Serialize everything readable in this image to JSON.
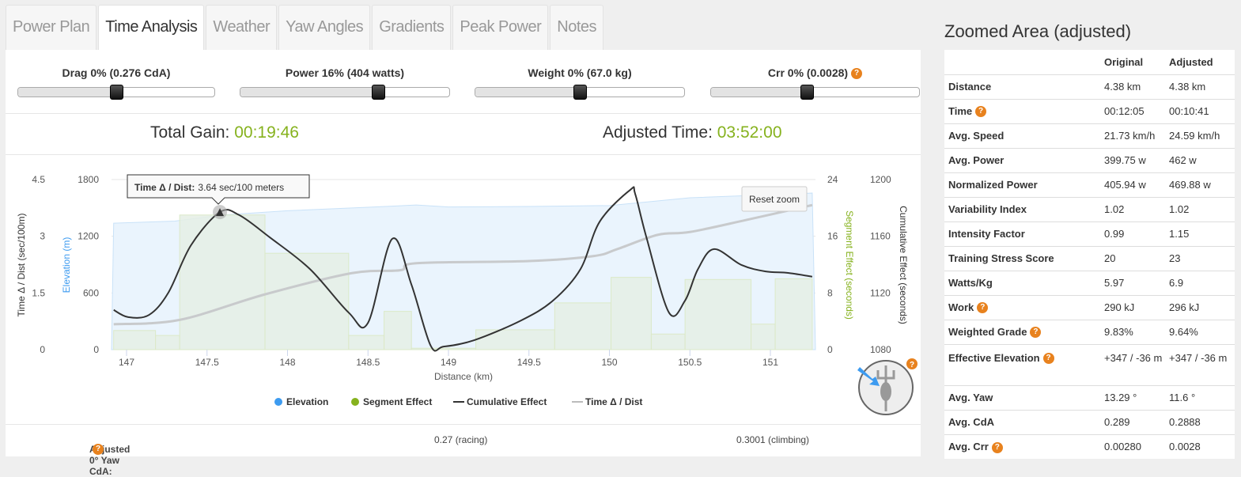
{
  "tabs": [
    {
      "label": "Power Plan"
    },
    {
      "label": "Time Analysis",
      "active": true
    },
    {
      "label": "Weather"
    },
    {
      "label": "Yaw Angles"
    },
    {
      "label": "Gradients"
    },
    {
      "label": "Peak Power"
    },
    {
      "label": "Notes"
    }
  ],
  "sliders": [
    {
      "label": "Drag 0% (0.276 CdA)",
      "value_pct": 50
    },
    {
      "label": "Power 16% (404 watts)",
      "value_pct": 66
    },
    {
      "label": "Weight 0% (67.0 kg)",
      "value_pct": 50
    },
    {
      "label": "Crr 0% (0.0028)",
      "value_pct": 46,
      "help": "?"
    }
  ],
  "summary": {
    "gain_label": "Total Gain:",
    "gain_value": "00:19:46",
    "adjusted_label": "Adjusted Time:",
    "adjusted_value": "03:52:00"
  },
  "colors": {
    "accent_green": "#86b21e",
    "elevation": "#3d9bf0",
    "help": "#e8821e"
  },
  "reset_zoom": "Reset zoom",
  "tooltip": {
    "label": "Time Δ / Dist:",
    "value": "3.64 sec/100 meters"
  },
  "chart_data": {
    "type": "line",
    "xlabel": "Distance (km)",
    "xlim": [
      146.92,
      151.26
    ],
    "xticks": [
      "147",
      "147.5",
      "148",
      "148.5",
      "149",
      "149.5",
      "150",
      "150.5",
      "151"
    ],
    "axes": {
      "time_dist": {
        "label": "Time Δ / Dist (sec/100m)",
        "range": [
          0,
          4.5
        ],
        "ticks": [
          "0",
          "1.5",
          "3",
          "4.5"
        ]
      },
      "elevation": {
        "label": "Elevation (m)",
        "range": [
          0,
          1800
        ],
        "ticks": [
          "0",
          "600",
          "1200",
          "1800"
        ]
      },
      "segment": {
        "label": "Segment Effect (seconds)",
        "range": [
          0,
          24
        ],
        "ticks": [
          "0",
          "8",
          "16",
          "24"
        ]
      },
      "cumulative": {
        "label": "Cumulative Effect (seconds)",
        "range": [
          1080,
          1200
        ],
        "ticks": [
          "1080",
          "1120",
          "1160",
          "1200"
        ]
      }
    },
    "legend": [
      "Elevation",
      "Segment Effect",
      "Cumulative Effect",
      "Time Δ / Dist"
    ],
    "legend_position": "bottom",
    "series": {
      "elevation": [
        [
          146.92,
          1339
        ],
        [
          147.3,
          1360
        ],
        [
          147.58,
          1423
        ],
        [
          148.0,
          1470
        ],
        [
          148.5,
          1507
        ],
        [
          148.8,
          1531
        ],
        [
          149.0,
          1510
        ],
        [
          149.5,
          1515
        ],
        [
          150.0,
          1525
        ],
        [
          150.5,
          1607
        ],
        [
          151.26,
          1657
        ]
      ],
      "segment_effect": [
        [
          146.92,
          147.18,
          2.7
        ],
        [
          147.18,
          147.33,
          2.0
        ],
        [
          147.33,
          147.86,
          19.0
        ],
        [
          147.86,
          148.38,
          13.6
        ],
        [
          148.38,
          148.6,
          2.0
        ],
        [
          148.6,
          148.77,
          5.4
        ],
        [
          148.77,
          149.17,
          0.2
        ],
        [
          149.17,
          149.66,
          2.8
        ],
        [
          149.66,
          150.01,
          6.6
        ],
        [
          150.01,
          150.26,
          10.2
        ],
        [
          150.26,
          150.47,
          2.2
        ],
        [
          150.47,
          150.88,
          9.9
        ],
        [
          150.88,
          151.03,
          3.6
        ],
        [
          151.03,
          151.26,
          10.0
        ]
      ],
      "time_dist": [
        [
          146.92,
          1.05
        ],
        [
          147.01,
          0.86
        ],
        [
          147.14,
          0.92
        ],
        [
          147.26,
          1.51
        ],
        [
          147.4,
          2.76
        ],
        [
          147.58,
          3.64
        ],
        [
          147.7,
          3.56
        ],
        [
          147.89,
          2.97
        ],
        [
          148.14,
          2.13
        ],
        [
          148.38,
          0.98
        ],
        [
          148.5,
          0.71
        ],
        [
          148.65,
          2.93
        ],
        [
          148.77,
          1.72
        ],
        [
          148.89,
          0.1
        ],
        [
          148.97,
          0.08
        ],
        [
          149.16,
          0.25
        ],
        [
          149.45,
          0.77
        ],
        [
          149.65,
          1.3
        ],
        [
          149.82,
          2.13
        ],
        [
          149.94,
          3.39
        ],
        [
          150.13,
          4.23
        ],
        [
          150.16,
          4.12
        ],
        [
          150.23,
          2.97
        ],
        [
          150.37,
          0.98
        ],
        [
          150.47,
          1.3
        ],
        [
          150.55,
          2.13
        ],
        [
          150.65,
          2.66
        ],
        [
          150.82,
          2.24
        ],
        [
          150.97,
          2.07
        ],
        [
          151.11,
          2.03
        ],
        [
          151.26,
          1.93
        ]
      ],
      "cumulative": [
        [
          146.92,
          1097.9
        ],
        [
          147.33,
          1101
        ],
        [
          147.86,
          1119
        ],
        [
          148.4,
          1134
        ],
        [
          148.7,
          1136
        ],
        [
          148.8,
          1141
        ],
        [
          149.5,
          1142.5
        ],
        [
          149.9,
          1146
        ],
        [
          150.05,
          1151
        ],
        [
          150.3,
          1161
        ],
        [
          150.5,
          1163
        ],
        [
          150.85,
          1171.5
        ],
        [
          151.26,
          1182
        ]
      ]
    }
  },
  "bottom": {
    "label": "Adjusted 0° Yaw CdA:",
    "racing": "0.27 (racing)",
    "climbing": "0.3001 (climbing)"
  },
  "side": {
    "title": "Zoomed Area (adjusted)",
    "headers": [
      "",
      "Original",
      "Adjusted"
    ],
    "rows": [
      {
        "label": "Distance",
        "original": "4.38 km",
        "adjusted": "4.38 km"
      },
      {
        "label": "Time",
        "help": true,
        "original": "00:12:05",
        "adjusted": "00:10:41"
      },
      {
        "label": "Avg. Speed",
        "original": "21.73 km/h",
        "adjusted": "24.59 km/h"
      },
      {
        "label": "Avg. Power",
        "original": "399.75 w",
        "adjusted": "462 w"
      },
      {
        "label": "Normalized Power",
        "original": "405.94 w",
        "adjusted": "469.88 w"
      },
      {
        "label": "Variability Index",
        "original": "1.02",
        "adjusted": "1.02"
      },
      {
        "label": "Intensity Factor",
        "original": "0.99",
        "adjusted": "1.15"
      },
      {
        "label": "Training Stress Score",
        "original": "20",
        "adjusted": "23"
      },
      {
        "label": "Watts/Kg",
        "original": "5.97",
        "adjusted": "6.9"
      },
      {
        "label": "Work",
        "help": true,
        "original": "290 kJ",
        "adjusted": "296 kJ"
      },
      {
        "label": "Weighted Grade",
        "help": true,
        "original": "9.83%",
        "adjusted": "9.64%"
      },
      {
        "label": "Effective Elevation",
        "help": true,
        "original": "+347 / -36 m",
        "adjusted": "+347 / -36 m"
      },
      {
        "label": "Avg. Yaw",
        "original": "13.29 °",
        "adjusted": "11.6 °"
      },
      {
        "label": "Avg. CdA",
        "original": "0.289",
        "adjusted": "0.2888"
      },
      {
        "label": "Avg. Crr",
        "help": true,
        "original": "0.00280",
        "adjusted": "0.0028"
      }
    ],
    "help_glyph": "?"
  }
}
